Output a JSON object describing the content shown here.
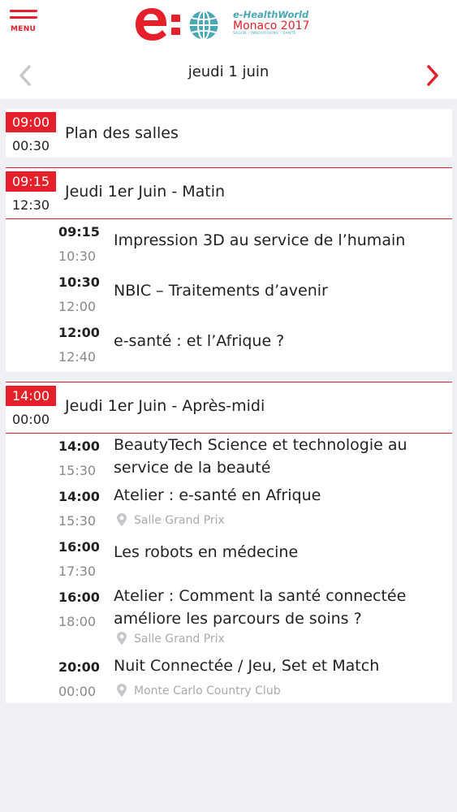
{
  "header": {
    "menu_label": "MENU",
    "logo": {
      "line1": "e-HealthWorld",
      "line2": "Monaco 2017",
      "line3": "SALON · INNOVATIONS · SANTÉ"
    }
  },
  "datebar": {
    "label": "jeudi 1 juin",
    "prev_icon": "chevron-left-icon",
    "next_icon": "chevron-right-icon"
  },
  "colors": {
    "accent": "#e5202a",
    "teal": "#4aa7b4",
    "muted": "#888888"
  },
  "sessions": [
    {
      "start": "09:00",
      "end": "00:30",
      "title": "Plan des salles",
      "items": []
    },
    {
      "start": "09:15",
      "end": "12:30",
      "title": "Jeudi 1er Juin - Matin",
      "items": [
        {
          "start": "09:15",
          "end": "10:30",
          "title": "Impression 3D au service de l’humain",
          "location": ""
        },
        {
          "start": "10:30",
          "end": "12:00",
          "title": "NBIC – Traitements d’avenir",
          "location": ""
        },
        {
          "start": "12:00",
          "end": "12:40",
          "title": "e-santé : et l’Afrique ?",
          "location": ""
        }
      ]
    },
    {
      "start": "14:00",
      "end": "00:00",
      "title": "Jeudi 1er Juin - Après-midi",
      "items": [
        {
          "start": "14:00",
          "end": "15:30",
          "title": "BeautyTech Science et technologie au service de la beauté",
          "location": ""
        },
        {
          "start": "14:00",
          "end": "15:30",
          "title": "Atelier : e-santé en Afrique",
          "location": "Salle Grand Prix"
        },
        {
          "start": "16:00",
          "end": "17:30",
          "title": "Les robots en médecine",
          "location": ""
        },
        {
          "start": "16:00",
          "end": "18:00",
          "title": "Atelier : Comment la santé connectée améliore les parcours de soins ?",
          "location": "Salle Grand Prix"
        },
        {
          "start": "20:00",
          "end": "00:00",
          "title": "Nuit Connectée / Jeu, Set et Match",
          "location": "Monte Carlo Country Club"
        }
      ]
    }
  ]
}
